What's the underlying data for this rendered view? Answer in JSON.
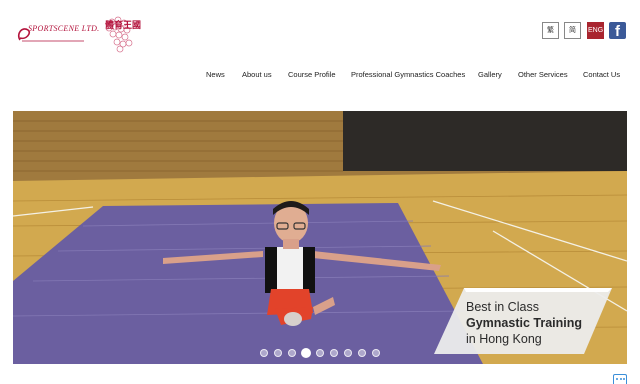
{
  "logo": {
    "text": "SPORTSCENE LTD.",
    "chinese": "體育王國"
  },
  "languages": [
    {
      "label": "繁",
      "active": false
    },
    {
      "label": "简",
      "active": false
    },
    {
      "label": "ENG",
      "active": true
    }
  ],
  "social": {
    "facebook_label": "f"
  },
  "nav": {
    "items": [
      {
        "label": "News"
      },
      {
        "label": "About us"
      },
      {
        "label": "Course Profile"
      },
      {
        "label": "Professional Gymnastics Coaches"
      },
      {
        "label": "Gallery"
      },
      {
        "label": "Other Services"
      },
      {
        "label": "Contact Us"
      }
    ]
  },
  "hero": {
    "caption_line1": "Best in Class",
    "caption_line2": "Gymnastic Training",
    "caption_line3": "in Hong Kong",
    "slide_count": 9,
    "active_slide": 4
  },
  "colors": {
    "brand": "#b3133c",
    "lang_active": "#a9252f",
    "facebook": "#3b5998",
    "floor": "#caa24a",
    "mat": "#6b5fa0"
  }
}
